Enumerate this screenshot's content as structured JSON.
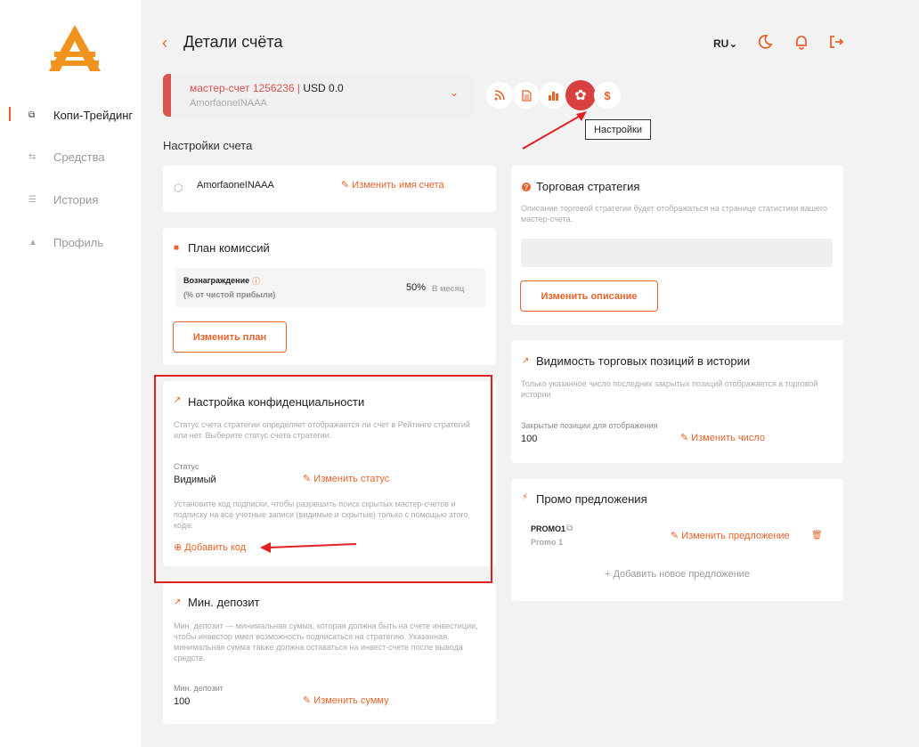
{
  "sidebar": {
    "items": [
      {
        "label": "Копи-Трейдинг",
        "icon": "copy-icon",
        "glyph": "⧉"
      },
      {
        "label": "Средства",
        "icon": "transfer-icon",
        "glyph": "⇆"
      },
      {
        "label": "История",
        "icon": "list-icon",
        "glyph": "☰"
      },
      {
        "label": "Профиль",
        "icon": "user-icon",
        "glyph": "▲"
      }
    ]
  },
  "header": {
    "back_glyph": "‹",
    "title": "Детали счёта",
    "lang": "RU⌄"
  },
  "account": {
    "name": "мастер-счет 1256236 |",
    "balance": "USD 0.0",
    "sub": "AmorfaoneINAAA",
    "chevron": "⌄"
  },
  "toolbar": {
    "icons": [
      "rss-icon",
      "document-icon",
      "chart-icon",
      "gear-icon",
      "dollar-icon"
    ],
    "tooltip": "Настройки"
  },
  "settings_label": "Настройки счета",
  "name_card": {
    "name": "AmorfaoneINAAA",
    "edit": "Изменить имя счета"
  },
  "commission": {
    "title": "План комиссий",
    "reward_label": "Вознаграждение",
    "reward_sub": "(% от чистой прибыли)",
    "value": "50%",
    "period": "В месяц",
    "button": "Изменить план"
  },
  "privacy": {
    "title": "Настройка конфиденциальности",
    "desc": "Статус счета стратегии определяет отображается ли счет в Рейтинге стратегий или нет. Выберите статус счета стратегии.",
    "status_label": "Статус",
    "status_value": "Видимый",
    "edit": "Изменить статус",
    "code_desc": "Установите код подписки, чтобы разрешить поиск скрытых мастер-счетов и подписку на все учетные записи (видимые и скрытые) только с помощью этого кода.",
    "add_code": "Добавить код"
  },
  "min_deposit": {
    "title": "Мин. депозит",
    "desc": "Мин. депозит — минимальная сумма, которая должна быть на счете инвестиции, чтобы инвестор имел возможность подписаться на стратегию. Указанная минимальная сумма также должна оставаться на инвест-счете после вывода средств.",
    "label": "Мин. депозит",
    "value": "100",
    "edit": "Изменить сумму"
  },
  "strategy": {
    "title": "Торговая стратегия",
    "desc": "Описание торговой стратегии будет отображаться на странице статистики вашего мастер-счета.",
    "button": "Изменить описание"
  },
  "visibility": {
    "title": "Видимость торговых позиций в истории",
    "desc": "Только указанное число последних закрытых позиций отображается в торговой истории",
    "label": "Закрытые позиции для отображения",
    "value": "100",
    "edit": "Изменить число"
  },
  "promo": {
    "title": "Промо предложения",
    "code": "PROMO1",
    "sub": "Promo 1",
    "edit": "Изменить предложение",
    "add": "+ Добавить новое предложение"
  },
  "colors": {
    "accent": "#e8632b",
    "danger": "#d94040",
    "highlight": "#e02020"
  }
}
